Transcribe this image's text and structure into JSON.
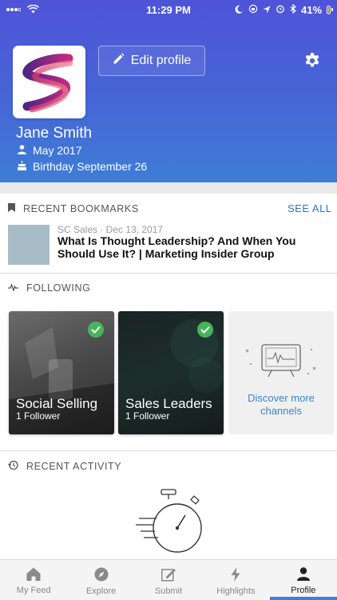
{
  "status": {
    "time": "11:29 PM",
    "battery": "41%"
  },
  "profile": {
    "edit_label": "Edit profile",
    "name": "Jane Smith",
    "joined": "May 2017",
    "birthday": "Birthday September 26"
  },
  "bookmarks": {
    "title": "RECENT BOOKMARKS",
    "see_all": "SEE ALL",
    "item": {
      "meta": "SC Sales · Dec 13, 2017",
      "title": "What Is Thought Leadership? And When You Should Use It? | Marketing Insider Group"
    }
  },
  "following": {
    "title": "FOLLOWING",
    "cards": [
      {
        "name": "Social Selling",
        "count": "1 Follower"
      },
      {
        "name": "Sales Leaders",
        "count": "1 Follower"
      }
    ],
    "discover_label": "Discover more channels"
  },
  "activity": {
    "title": "RECENT ACTIVITY"
  },
  "tabs": [
    {
      "label": "My Feed",
      "icon": "home-icon"
    },
    {
      "label": "Explore",
      "icon": "compass-icon"
    },
    {
      "label": "Submit",
      "icon": "edit-icon"
    },
    {
      "label": "Highlights",
      "icon": "bolt-icon"
    },
    {
      "label": "Profile",
      "icon": "person-icon"
    }
  ],
  "colors": {
    "header_top": "#4e54d8",
    "header_bottom": "#3e7dd6",
    "accent": "#2a74c9",
    "check": "#47b35a"
  }
}
